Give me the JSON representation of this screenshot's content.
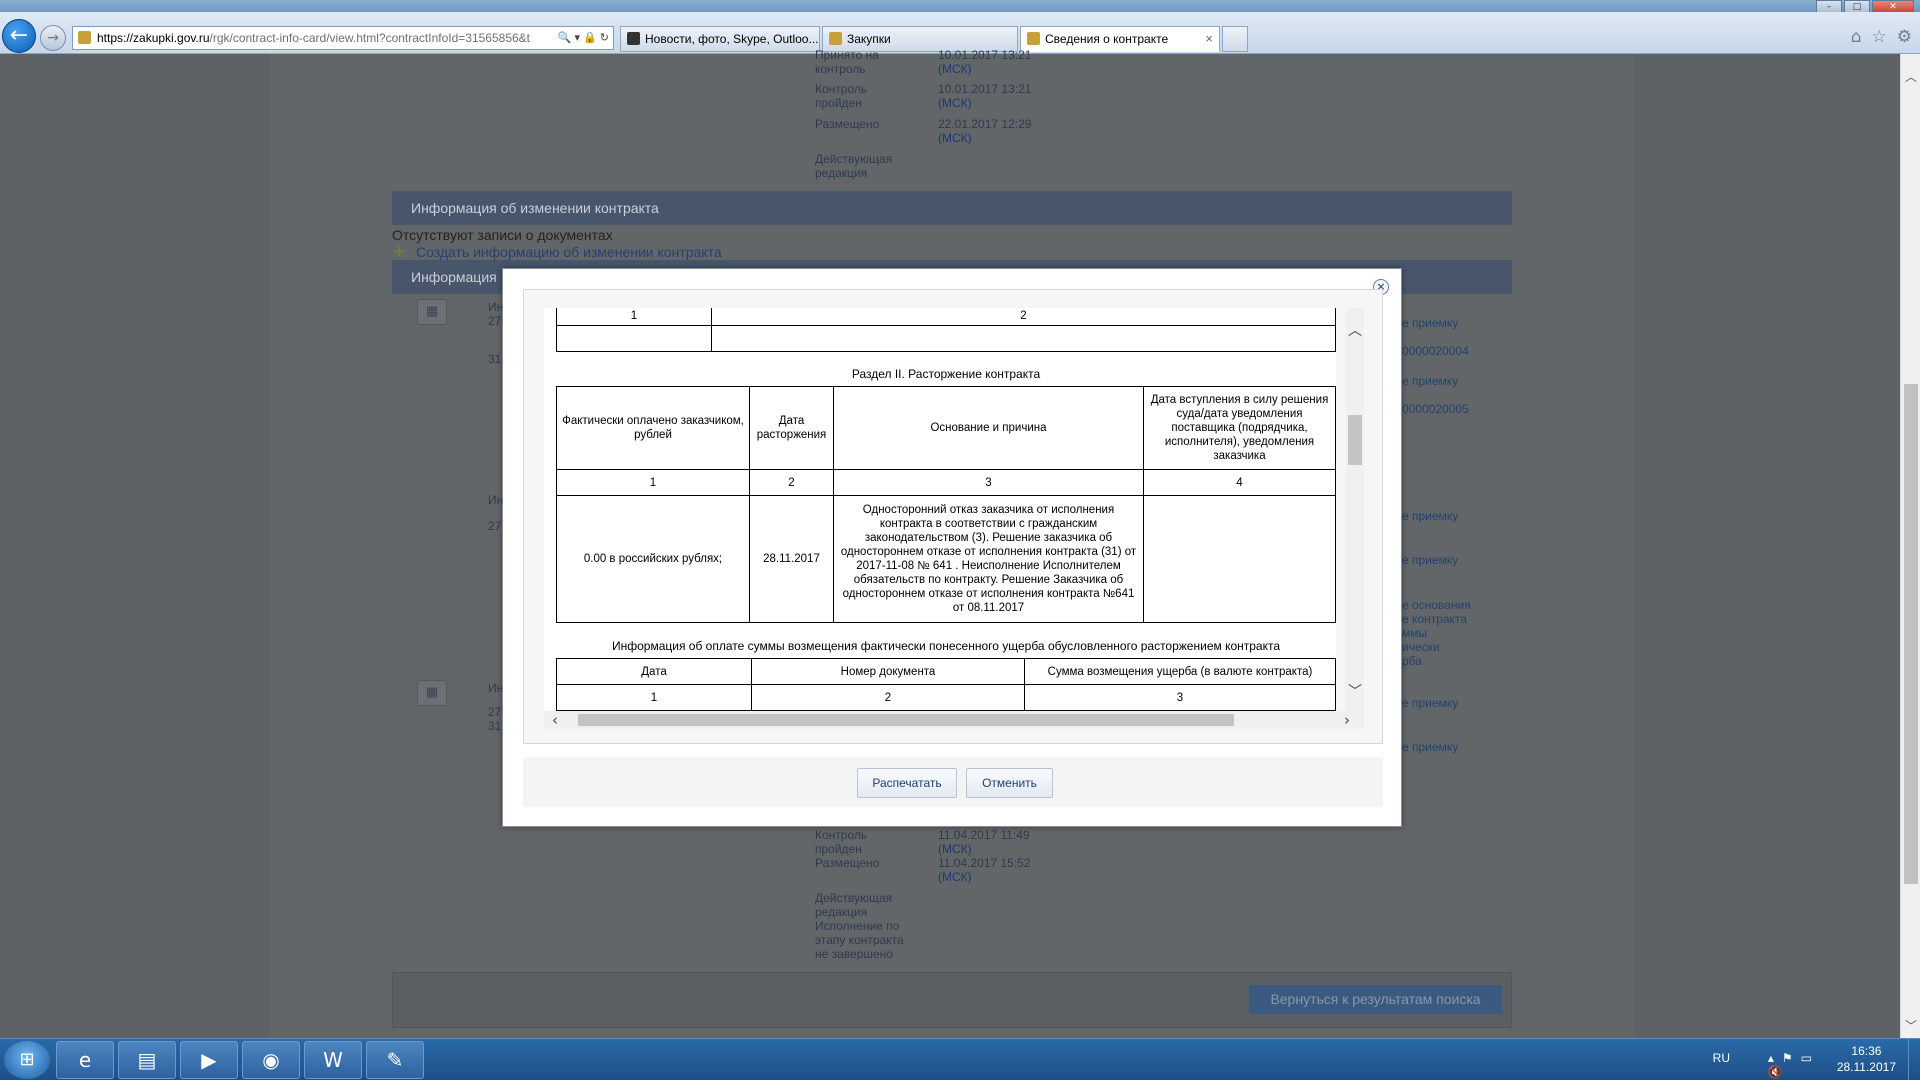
{
  "browser": {
    "url_host": "https://zakupki.gov.ru",
    "url_path": "/rgk/contract-info-card/view.html?contractInfoId=31565856&t",
    "tabs": [
      {
        "label": "Новости, фото, Skype, Outloo...",
        "icon": "yandex-icon"
      },
      {
        "label": "Закупки",
        "icon": "emblem-icon"
      },
      {
        "label": "Сведения о контракте",
        "icon": "emblem-icon",
        "active": true
      }
    ],
    "close_tab_glyph": "×"
  },
  "background_page": {
    "top_entry": [
      {
        "label": "Принято на контроль",
        "value": "10.01.2017 13:21",
        "tz": "(МСК)"
      },
      {
        "label": "Контроль пройден",
        "value": "10.01.2017 13:21",
        "tz": "(МСК)"
      },
      {
        "label": "Размещено",
        "value": "22.01.2017 12:29",
        "tz": "(МСК)"
      },
      {
        "label": "Действующая редакция",
        "value": "",
        "tz": ""
      }
    ],
    "section_changes": "Информация об изменении контракта",
    "no_records": "Отсутствуют записи о документах",
    "create_link": "Создать информацию об изменении контракта",
    "section_execution": "Информация",
    "side_links": [
      "е приемку",
      "0000020004",
      "е приемку",
      "0000020005",
      "е приемку",
      "е приемку",
      "е основания",
      "е контракта",
      "ммы",
      "ически",
      "рба",
      "е приемку",
      "е приемку"
    ],
    "left_fragments": [
      "Ин",
      "27",
      "31",
      "Ин",
      "27",
      "Ин",
      "27",
      "31"
    ],
    "bottom_entry": [
      {
        "label": "Контроль пройден",
        "value": "11.04.2017 11:49",
        "tz": "(МСК)"
      },
      {
        "label": "Размещено",
        "value": "11.04.2017 15:52",
        "tz": "(МСК)"
      },
      {
        "label": "Действующая редакция",
        "value": "",
        "tz": ""
      },
      {
        "label": "Исполнение по этапу контракта не завершено",
        "value": "",
        "tz": ""
      }
    ],
    "return_button": "Вернуться к результатам поиска"
  },
  "modal": {
    "close_glyph": "×",
    "top_table": {
      "col1": "1",
      "col2": "2"
    },
    "section2_title": "Раздел II. Расторжение контракта",
    "termination_table": {
      "headers": [
        "Фактически оплачено заказчиком, рублей",
        "Дата расторжения",
        "Основание и причина",
        "Дата вступления в силу решения суда/дата уведомления поставщика (подрядчика, исполнителя), уведомления заказчика"
      ],
      "numbers": [
        "1",
        "2",
        "3",
        "4"
      ],
      "row": [
        "0.00 в российских рублях;",
        "28.11.2017",
        "Односторонний отказ заказчика от исполнения контракта в соответствии с гражданским законодательством (3).  Решение заказчика об одностороннем отказе от исполнения контракта (31) от 2017-11-08 № 641 .  Неисполнение Исполнителем обязательств по контракту. Решение Заказчика об одностороннем отказе от исполнения контракта №641 от 08.11.2017",
        ""
      ]
    },
    "damages_title": "Информация об оплате суммы возмещения фактически понесенного ущерба обусловленного расторжением контракта",
    "damages_table": {
      "headers": [
        "Дата",
        "Номер документа",
        "Сумма возмещения ущерба (в валюте контракта)"
      ],
      "numbers": [
        "1",
        "2",
        "3"
      ]
    },
    "buttons": {
      "print": "Распечатать",
      "cancel": "Отменить"
    }
  },
  "taskbar": {
    "apps": [
      "internet-explorer-icon",
      "file-explorer-icon",
      "media-player-icon",
      "chrome-icon",
      "word-icon",
      "paint-icon"
    ],
    "lang": "RU",
    "time": "16:36",
    "date": "28.11.2017"
  }
}
